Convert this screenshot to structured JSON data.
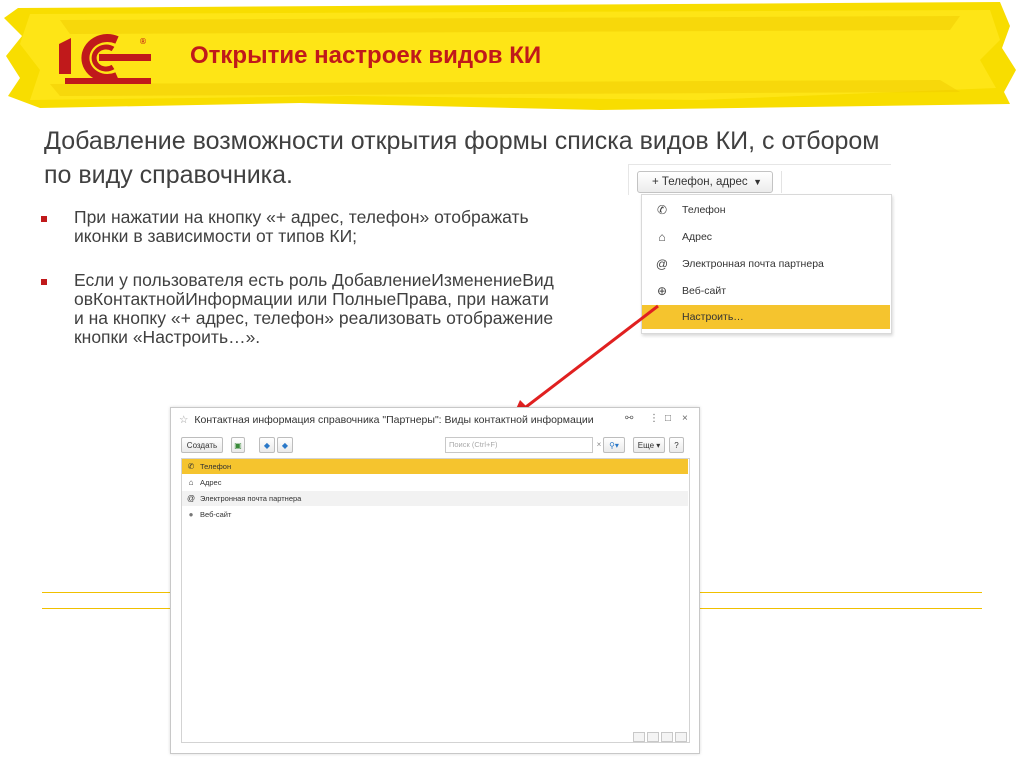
{
  "header": {
    "title": "Открытие настроек видов КИ",
    "logo_text": "1С",
    "brand_color": "#c0191b",
    "accent_yellow": "#f8dd00"
  },
  "subtitle": "Добавление возможности открытия формы списка видов КИ, с отбором по виду справочника.",
  "bullets": [
    "При нажатии на кнопку «+ адрес, телефон» отображать иконки в зависимости от типов КИ;",
    "Если у пользователя есть роль ДобавлениеИзменениеВидовКонтактнойИнформации или ПолныеПрава, при нажатии на кнопку «+ адрес, телефон» реализовать отображение кнопки «Настроить…»."
  ],
  "dropdown": {
    "button_label": "+ Телефон, адрес",
    "items": [
      {
        "icon": "phone-icon",
        "glyph": "✆",
        "label": "Телефон"
      },
      {
        "icon": "home-icon",
        "glyph": "⌂",
        "label": "Адрес"
      },
      {
        "icon": "at-icon",
        "glyph": "@",
        "label": "Электронная почта партнера"
      },
      {
        "icon": "globe-icon",
        "glyph": "⊕",
        "label": "Веб-сайт"
      },
      {
        "icon": "",
        "glyph": "",
        "label": "Настроить…"
      }
    ]
  },
  "form": {
    "title": "Контактная информация справочника \"Партнеры\": Виды контактной информации",
    "create_label": "Создать",
    "search_placeholder": "Поиск (Ctrl+F)",
    "more_label": "Еще ▾",
    "help_label": "?",
    "rows": [
      {
        "icon": "phone-icon",
        "glyph": "✆",
        "label": "Телефон"
      },
      {
        "icon": "home-icon",
        "glyph": "⌂",
        "label": "Адрес"
      },
      {
        "icon": "at-icon",
        "glyph": "@",
        "label": "Электронная почта партнера"
      },
      {
        "icon": "globe-icon",
        "glyph": "●",
        "label": "Веб-сайт"
      }
    ]
  },
  "colors": {
    "highlight": "#f5c42e",
    "arrow": "#e02020"
  }
}
